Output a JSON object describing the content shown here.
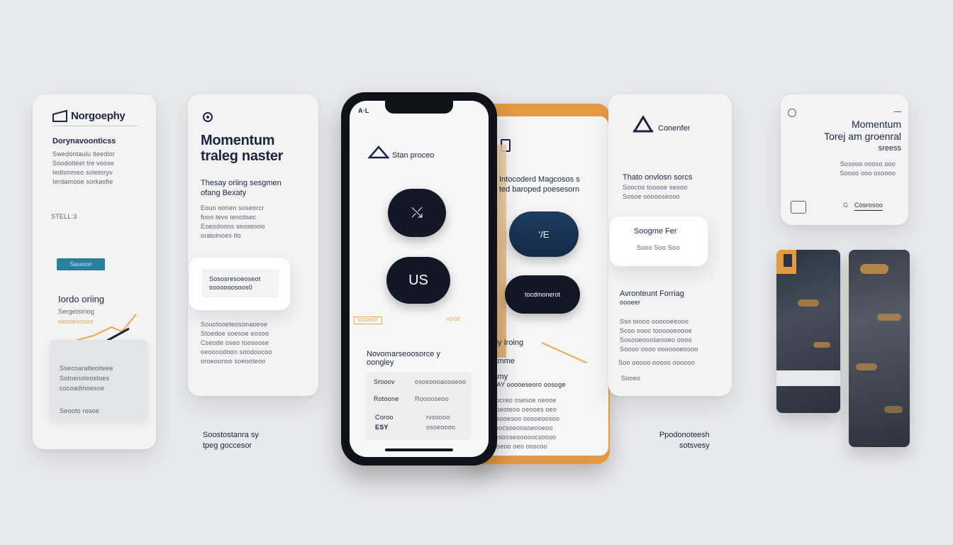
{
  "card1": {
    "title": "Norgoephy",
    "subtitle": "Dorynavoonticss",
    "body": [
      "Swedontaulu tleedior",
      "Soodotteet tre voose",
      "Iedtonmeo soletoryv",
      "Ierdamooe sorkasfie"
    ],
    "label": "STELL:3",
    "button_label": "Sausson",
    "section_title": "Iordo oriing",
    "section_sub": "Sergetstriog",
    "section_meta": "sesoesosos",
    "panel_lines": [
      "Ssecoaralteoiteee",
      "Sotnenoleostoes",
      "cocoadinoesoe"
    ],
    "panel_footer": "Seooto rosoe"
  },
  "card2": {
    "icon": "location-icon",
    "title_line1": "Momentum",
    "title_line2": "traleg naster",
    "sub_line1": "Thesay oriing sesgmen",
    "sub_line2": "ofang Bexaty",
    "body": [
      "Eoun oonen soseorcr",
      "fooo tevo iencitsec",
      "Eoeodoons seoseooo",
      "oratoinoes tlo"
    ],
    "floating_lines": [
      "Sososresoeoseot",
      "soooooosoos0"
    ],
    "para": [
      "Souotooeteosonaoeoe",
      "Stoedoe soesoe eosoo",
      "Cseode oseo toosoose",
      "oeoooodoon soodoocoo",
      "oroeoonoo soeooteoo"
    ],
    "footer_line1": "Soostostanra sy",
    "footer_line2": "tpeg goccesor"
  },
  "phone": {
    "status_left": "A·L",
    "brand_name": "Stan proceo",
    "pill1": "⤯",
    "pill2": "US",
    "tag_left": "SOOKEE",
    "tag_right": "SOOE",
    "section_title_line1": "Novomarseoosorce y",
    "section_title_line2": "oongley",
    "rows": [
      {
        "label": "Srooov",
        "value": "osoeoooaoooeoo"
      },
      {
        "label": "Rotoone",
        "value": "Rooooseoo"
      },
      {
        "label": "Coroo",
        "value": "rvsoooo"
      },
      {
        "label": "ESY",
        "value": "osoeoooo"
      }
    ]
  },
  "back_phone": {
    "headline_line1": "Intocoderd Magcosos s",
    "headline_line2": "ted baroped poesesorn",
    "pill1": "'/E",
    "pill2": "tocdmonerot",
    "section_title": "Iioly Iroing",
    "section_sub1": "Kamme",
    "section_sub2": "Pamy",
    "section_sub3": "PEAY ooooeseoro oosoge",
    "para": [
      "Seocreo osesoe oeooe",
      "Seoeoteoo oeooes oeo",
      "Soeooesoo oosoeoosoo",
      "Tooocsoeoosoeooeoo",
      "ocesooseooooocsoooo",
      "Cooeoo oeo ooscoo"
    ]
  },
  "card4": {
    "brand_name": "Conenfer",
    "body": [
      "Thato onvlosn sorcs",
      "Soocoo tooooe seooo",
      "Sosoe oooooseooo"
    ],
    "floating_title": "Soogme Fer",
    "floating_meta": "Sooo Soo Soo",
    "section_title_line1": "Avronteunt Forriag",
    "section_title_line2": "oooeer",
    "para": [
      "Sso toooo oooooeeooo",
      "Scoo oooc toooooeoooe",
      "Sosooeoooseooeo oooo",
      "Soooo oooo ooooooeoooo"
    ],
    "foot1": "Soo ooooo ooooo oooooo",
    "foot2": "Sooeo",
    "footer_line1": "Ppodonoteesh",
    "footer_line2": "sotsvesy"
  },
  "card5": {
    "title_line1": "Momentum",
    "title_line2": "Torej am groenral",
    "title_line3": "sreess",
    "body": [
      "Sosooo oooso ooo",
      "Soooo ooo osoooo"
    ],
    "link": "Cosrosoo",
    "small_label": "G"
  },
  "colors": {
    "accent": "#f0a64a",
    "navy": "#1c2540",
    "blue_pill": "#1d3d60",
    "teal_button": "#2a7f9e"
  }
}
